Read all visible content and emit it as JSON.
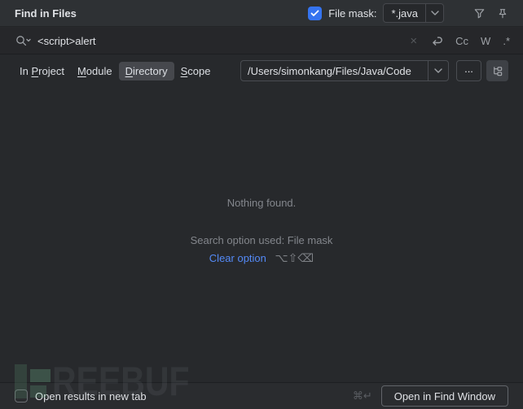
{
  "colors": {
    "accent": "#3574F0",
    "link": "#548AF7"
  },
  "titlebar": {
    "title": "Find in Files",
    "file_mask": {
      "label": "File mask:",
      "value": "*.java",
      "checked": true
    }
  },
  "search": {
    "query": "<script>alert",
    "controls": {
      "clear": "×",
      "match_case": "Cc",
      "words": "W",
      "regex": ".*"
    }
  },
  "scope_tabs": [
    {
      "pre": "In ",
      "mnemonic": "P",
      "post": "roject",
      "selected": false
    },
    {
      "pre": "",
      "mnemonic": "M",
      "post": "odule",
      "selected": false
    },
    {
      "pre": "",
      "mnemonic": "D",
      "post": "irectory",
      "selected": true
    },
    {
      "pre": "",
      "mnemonic": "S",
      "post": "cope",
      "selected": false
    }
  ],
  "directory": {
    "path": "/Users/simonkang/Files/Java/Code",
    "browse_label": "..."
  },
  "results": {
    "empty_title": "Nothing found.",
    "option_note": "Search option used: File mask",
    "clear_link": "Clear option",
    "clear_shortcut": "⌥⇧⌫"
  },
  "footer": {
    "open_in_new_tab_label": "Open results in new tab",
    "shortcut": "⌘↵",
    "button_label": "Open in Find Window"
  },
  "watermark": {
    "text": "REEBUF"
  }
}
